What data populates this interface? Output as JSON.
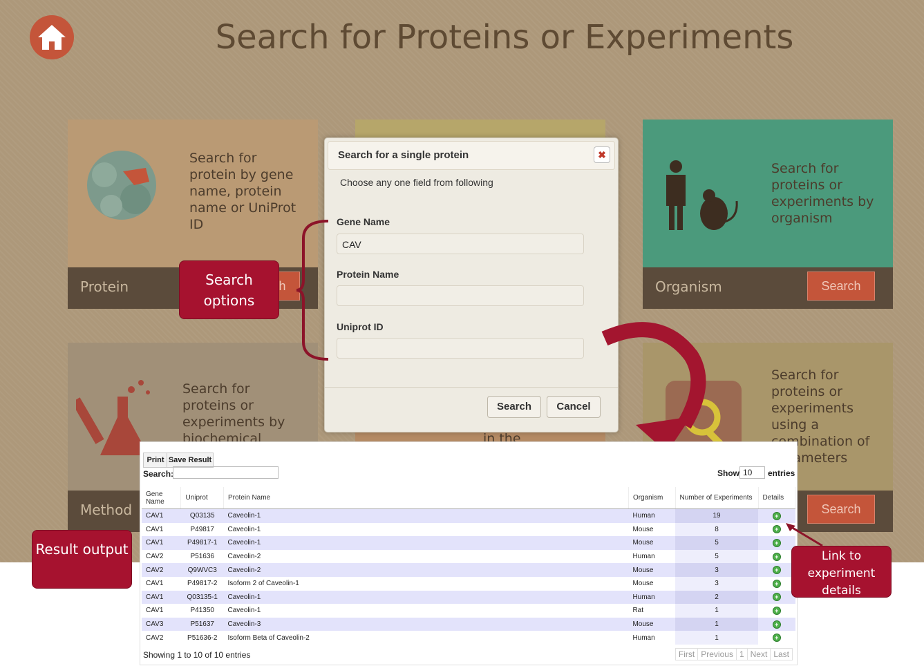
{
  "page": {
    "title": "Search for Proteins or Experiments"
  },
  "tiles": {
    "protein": {
      "text": "Search for protein by gene name, protein name or UniProt ID",
      "label": "Protein",
      "button": "Search"
    },
    "organism": {
      "text": "Search for proteins or experiments by organism",
      "label": "Organism",
      "button": "Search"
    },
    "method": {
      "text": "Search for proteins or experiments by biochemical",
      "label": "Method"
    },
    "middle_bottom": {
      "text": "in the"
    },
    "combination": {
      "text": "Search for proteins or experiments using a combination of parameters",
      "button": "Search"
    }
  },
  "modal": {
    "title": "Search for a single protein",
    "close": "✖",
    "subtitle": "Choose any one field from following",
    "gene_label": "Gene Name",
    "gene_value": "CAV",
    "protein_label": "Protein Name",
    "protein_value": "",
    "uniprot_label": "Uniprot ID",
    "uniprot_value": "",
    "search_button": "Search",
    "cancel_button": "Cancel"
  },
  "callouts": {
    "search_options": "Search options",
    "result_output": "Result output",
    "link_details": "Link to experiment details"
  },
  "results": {
    "print_button": "Print",
    "save_button": "Save Result",
    "search_label": "Search:",
    "show_label": "Show",
    "entries_value": "10",
    "entries_label": "entries",
    "columns": [
      "Gene Name",
      "Uniprot",
      "Protein Name",
      "Organism",
      "Number of Experiments",
      "Details"
    ],
    "rows": [
      [
        "CAV1",
        "Q03135",
        "Caveolin-1",
        "Human",
        "19"
      ],
      [
        "CAV1",
        "P49817",
        "Caveolin-1",
        "Mouse",
        "8"
      ],
      [
        "CAV1",
        "P49817-1",
        "Caveolin-1",
        "Mouse",
        "5"
      ],
      [
        "CAV2",
        "P51636",
        "Caveolin-2",
        "Human",
        "5"
      ],
      [
        "CAV2",
        "Q9WVC3",
        "Caveolin-2",
        "Mouse",
        "3"
      ],
      [
        "CAV1",
        "P49817-2",
        "Isoform 2 of Caveolin-1",
        "Mouse",
        "3"
      ],
      [
        "CAV1",
        "Q03135-1",
        "Caveolin-1",
        "Human",
        "2"
      ],
      [
        "CAV1",
        "P41350",
        "Caveolin-1",
        "Rat",
        "1"
      ],
      [
        "CAV3",
        "P51637",
        "Caveolin-3",
        "Mouse",
        "1"
      ],
      [
        "CAV2",
        "P51636-2",
        "Isoform Beta of Caveolin-2",
        "Human",
        "1"
      ]
    ],
    "info": "Showing 1 to 10 of 10 entries",
    "pager": [
      "First",
      "Previous",
      "1",
      "Next",
      "Last"
    ]
  }
}
